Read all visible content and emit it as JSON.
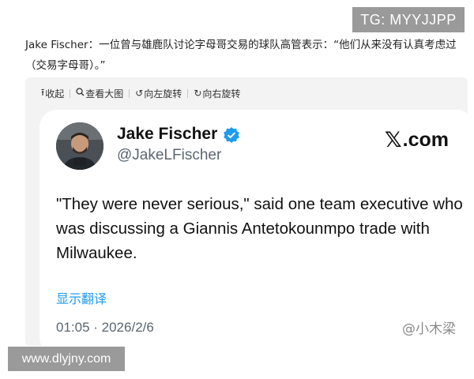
{
  "watermark_top": "TG: MYYJJPP",
  "headline": "Jake Fischer：一位曾与雄鹿队讨论字母哥交易的球队高管表示：“他们从来没有认真考虑过（交易字母哥）。”",
  "toolbar": {
    "collapse_label": "收起",
    "view_large_label": "查看大图",
    "rotate_left_label": "向左旋转",
    "rotate_right_label": "向右旋转"
  },
  "tweet": {
    "display_name": "Jake Fischer",
    "handle": "@JakeLFischer",
    "platform": ".com",
    "text": "\"They were never serious,\" said one team executive who was discussing a Giannis Antetokounmpo trade with Milwaukee.",
    "translate_label": "显示翻译",
    "timestamp": "01:05 · 2026/2/6",
    "verified_color": "#1d9bf0"
  },
  "user_watermark": "@小木梁",
  "watermark_bottom": "www.dlyjny.com"
}
